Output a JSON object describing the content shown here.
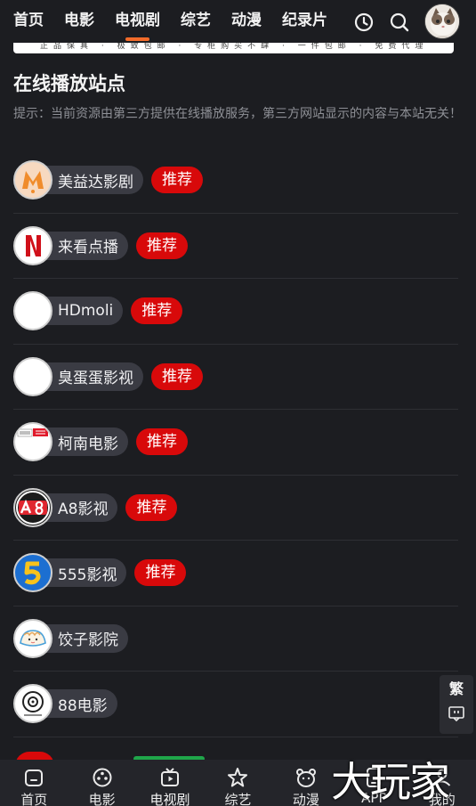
{
  "nav": {
    "items": [
      {
        "label": "首页",
        "active": false
      },
      {
        "label": "电影",
        "active": false
      },
      {
        "label": "电视剧",
        "active": true
      },
      {
        "label": "综艺",
        "active": false
      },
      {
        "label": "动漫",
        "active": false
      },
      {
        "label": "纪录片",
        "active": false
      }
    ],
    "accent": "#f26b2a",
    "icons": [
      "history-icon",
      "search-icon",
      "avatar"
    ]
  },
  "banner_text": "正品保真 · 极致包邮 · 专柜购买不肆 · 一件包邮 · 免费代理",
  "section": {
    "title": "在线播放站点",
    "notice": "提示：当前资源由第三方提供在线播放服务，第三方网站显示的内容与本站无关！"
  },
  "recommend_label": "推荐",
  "sites": [
    {
      "name": "美益达影剧",
      "recommended": true,
      "logo": "meiyida-logo"
    },
    {
      "name": "来看点播",
      "recommended": true,
      "logo": "netflix-n-logo"
    },
    {
      "name": "HDmoli",
      "recommended": true,
      "logo": "blank-logo"
    },
    {
      "name": "臭蛋蛋影视",
      "recommended": true,
      "logo": "blank-logo"
    },
    {
      "name": "柯南电影",
      "recommended": true,
      "logo": "kenan-logo"
    },
    {
      "name": "A8影视",
      "recommended": true,
      "logo": "a8-logo"
    },
    {
      "name": "555影视",
      "recommended": true,
      "logo": "555-logo"
    },
    {
      "name": "饺子影院",
      "recommended": false,
      "logo": "dumpling-logo"
    },
    {
      "name": "88电影",
      "recommended": false,
      "logo": "88-logo"
    }
  ],
  "float": {
    "traditional_label": "繁",
    "chat_icon": "chat-icon"
  },
  "tabbar": [
    {
      "label": "首页",
      "icon": "home-icon"
    },
    {
      "label": "电影",
      "icon": "film-reel-icon"
    },
    {
      "label": "电视剧",
      "icon": "tv-icon"
    },
    {
      "label": "综艺",
      "icon": "star-icon"
    },
    {
      "label": "动漫",
      "icon": "cartoon-face-icon"
    },
    {
      "label": "APP",
      "icon": "phone-icon"
    },
    {
      "label": "我的",
      "icon": "user-icon"
    }
  ],
  "watermark": "大玩家",
  "colors": {
    "background": "#1c1d21",
    "pill": "#3a3b43",
    "recommend": "#d8090a"
  }
}
